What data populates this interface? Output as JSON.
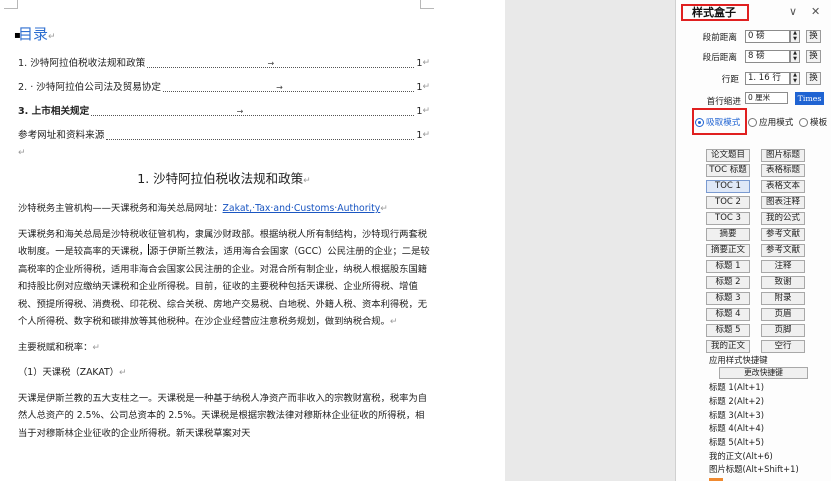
{
  "document": {
    "toc_title": "目录",
    "para_mark": "↵",
    "toc": [
      {
        "text": "1. 沙特阿拉伯税收法规和政策",
        "page": "1",
        "bold": false
      },
      {
        "text": "2. · 沙特阿拉伯公司法及贸易协定",
        "page": "1",
        "bold": false
      },
      {
        "text": "3. 上市相关规定",
        "page": "1",
        "bold": true
      },
      {
        "text": "参考网址和资料来源",
        "page": "1",
        "bold": false
      }
    ],
    "heading1": "1. 沙特阿拉伯税收法规和政策",
    "p1_prefix": "沙特税务主管机构——天课税务和海关总局网址：",
    "p1_link": "Zakat,·Tax·and·Customs·Authority",
    "p2_before_caret": "天课税务和海关总局是沙特税收征管机构，隶属沙财政部。根据纳税人所有制结构，沙特现行两套税收制度。一是较高率的天课税，",
    "p2_after_caret": "源于伊斯兰教法，适用海合会国家（GCC）公民注册的企业；二是较高税率的企业所得税，适用非海合会国家公民注册的企业。对混合所有制企业，纳税人根据股东国籍和持股比例对应缴纳天课税和企业所得税。目前，征收的主要税种包括天课税、企业所得税、增值税、预提所得税、消费税、印花税、综合关税、房地产交易税、白地税、外籍人税、资本利得税，无个人所得税、数字税和碳排放等其他税种。在沙企业经营应注意税务规划，做到纳税合规。",
    "p3": "主要税赋和税率：",
    "p4": "（1）天课税（ZAKAT）",
    "p5": "天课是伊斯兰教的五大支柱之一。天课税是一种基于纳税人净资产而非收入的宗教财富税，税率为自然人总资产的 2.5%、公司总资本的 2.5%。天课税是根据宗教法律对穆斯林企业征收的所得税，相当于对穆斯林企业征收的企业所得税。新天课税草案对天"
  },
  "panel": {
    "title": "样式盒子",
    "collapse_icon": "chevron-down-icon",
    "close_icon": "close-icon",
    "spacing": {
      "before_label": "段前距离",
      "before_value": "0 磅",
      "after_label": "段后距离",
      "after_value": "8 磅",
      "line_label": "行距",
      "line_value": "1. 16 行",
      "indent_label": "首行缩进",
      "indent_value": "0 厘米",
      "swap_label": "换",
      "font_button": "Times"
    },
    "modes": {
      "absorb": "吸取模式",
      "apply": "应用模式",
      "template": "模板"
    },
    "styles_left": [
      "论文题目",
      "TOC 标题",
      "TOC 1",
      "TOC 2",
      "TOC 3",
      "摘要",
      "摘要正文",
      "标题 1",
      "标题 2",
      "标题 3",
      "标题 4",
      "标题 5",
      "我的正文"
    ],
    "styles_right": [
      "图片标题",
      "表格标题",
      "表格文本",
      "图表注释",
      "我的公式",
      "参考文献",
      "参考文献",
      "注释",
      "致谢",
      "附录",
      "页眉",
      "页脚",
      "空行"
    ],
    "shortcut_header": "应用样式快捷键",
    "change_shortcut": "更改快捷键",
    "shortcuts": [
      "标题 1(Alt+1)",
      "标题 2(Alt+2)",
      "标题 3(Alt+3)",
      "标题 4(Alt+4)",
      "标题 5(Alt+5)",
      "我的正文(Alt+6)",
      "图片标题(Alt+Shift+1)"
    ]
  },
  "colors": {
    "accent_blue": "#1f63d2",
    "highlight_red": "#e02020",
    "toc_blue": "#2f6fd0"
  }
}
